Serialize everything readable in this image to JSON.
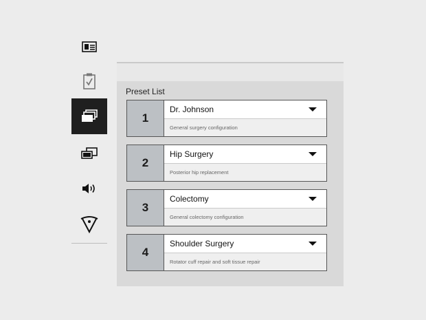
{
  "sidebar": {
    "items": [
      {
        "icon": "id-card-icon"
      },
      {
        "icon": "clipboard-check-icon"
      },
      {
        "icon": "stacked-windows-icon",
        "active": true
      },
      {
        "icon": "dual-display-icon"
      },
      {
        "icon": "speaker-icon"
      },
      {
        "icon": "surgical-light-icon"
      }
    ]
  },
  "panel": {
    "title": "Preset List",
    "presets": [
      {
        "number": "1",
        "name": "Dr. Johnson",
        "description": "General surgery configuration"
      },
      {
        "number": "2",
        "name": "Hip Surgery",
        "description": "Posterior hip replacement"
      },
      {
        "number": "3",
        "name": "Colectomy",
        "description": "General colectomy configuration"
      },
      {
        "number": "4",
        "name": "Shoulder Surgery",
        "description": "Rotator cuff repair and soft tissue repair"
      }
    ]
  },
  "colors": {
    "active_nav": "#1f1f1f",
    "panel_bg": "#d9d9d9",
    "number_bg": "#bcc0c4"
  }
}
